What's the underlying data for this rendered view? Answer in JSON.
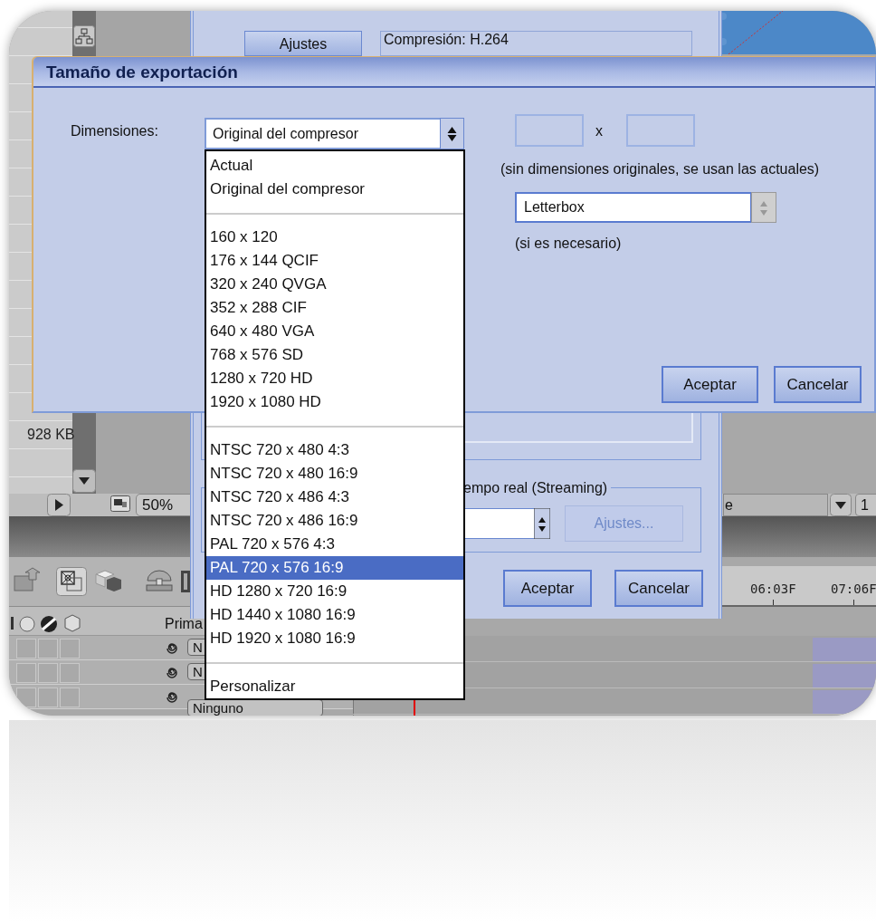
{
  "background": {
    "file_size": "928 KB",
    "zoom": "50%",
    "layer_column": "Prima",
    "layers": [
      {
        "switches": [
          false,
          false,
          false
        ],
        "mode": "N"
      },
      {
        "switches": [
          false,
          false,
          false
        ],
        "mode": "N"
      },
      {
        "switches": [
          false,
          false,
          false
        ],
        "mode": "Ninguno"
      }
    ],
    "view_field": "e",
    "resolution": "1",
    "timeline_ticks": [
      "06:03F",
      "07:06F"
    ]
  },
  "export_dialog": {
    "settings_button": "Ajustes",
    "compression": "Compresión: H.264",
    "streaming_group": "empo real (Streaming)",
    "streaming_settings": {
      "label": "Ajustes...",
      "disabled": true
    },
    "buttons": [
      "Aceptar",
      "Cancelar"
    ]
  },
  "size_dialog": {
    "title": "Tamaño de exportación",
    "dimensions_label": "Dimensiones:",
    "dimensions_value": "Original del compresor",
    "times": "x",
    "note": "(sin dimensiones originales, se usan las actuales)",
    "fit_value": "Letterbox",
    "fit_note": "(si es necesario)",
    "buttons": [
      "Aceptar",
      "Cancelar"
    ]
  },
  "dimensions_list": [
    {
      "kind": "option",
      "label": "Actual",
      "selected": false
    },
    {
      "kind": "option",
      "label": "Original del compresor",
      "selected": false
    },
    {
      "kind": "separator"
    },
    {
      "kind": "option",
      "label": "160 x 120",
      "selected": false
    },
    {
      "kind": "option",
      "label": "176 x 144 QCIF",
      "selected": false
    },
    {
      "kind": "option",
      "label": "320 x 240 QVGA",
      "selected": false
    },
    {
      "kind": "option",
      "label": "352 x 288 CIF",
      "selected": false
    },
    {
      "kind": "option",
      "label": "640 x 480 VGA",
      "selected": false
    },
    {
      "kind": "option",
      "label": "768 x 576 SD",
      "selected": false
    },
    {
      "kind": "option",
      "label": "1280 x 720 HD",
      "selected": false
    },
    {
      "kind": "option",
      "label": "1920 x 1080 HD",
      "selected": false
    },
    {
      "kind": "separator"
    },
    {
      "kind": "option",
      "label": "NTSC 720 x 480 4:3",
      "selected": false
    },
    {
      "kind": "option",
      "label": "NTSC 720 x 480 16:9",
      "selected": false
    },
    {
      "kind": "option",
      "label": "NTSC 720 x 486 4:3",
      "selected": false
    },
    {
      "kind": "option",
      "label": "NTSC 720 x 486 16:9",
      "selected": false
    },
    {
      "kind": "option",
      "label": "PAL 720 x 576 4:3",
      "selected": false
    },
    {
      "kind": "option",
      "label": "PAL 720 x 576 16:9",
      "selected": true
    },
    {
      "kind": "option",
      "label": "HD 1280 x 720 16:9",
      "selected": false
    },
    {
      "kind": "option",
      "label": "HD 1440 x 1080 16:9",
      "selected": false
    },
    {
      "kind": "option",
      "label": "HD 1920 x 1080 16:9",
      "selected": false
    },
    {
      "kind": "separator"
    },
    {
      "kind": "option",
      "label": "Personalizar",
      "selected": false
    }
  ]
}
